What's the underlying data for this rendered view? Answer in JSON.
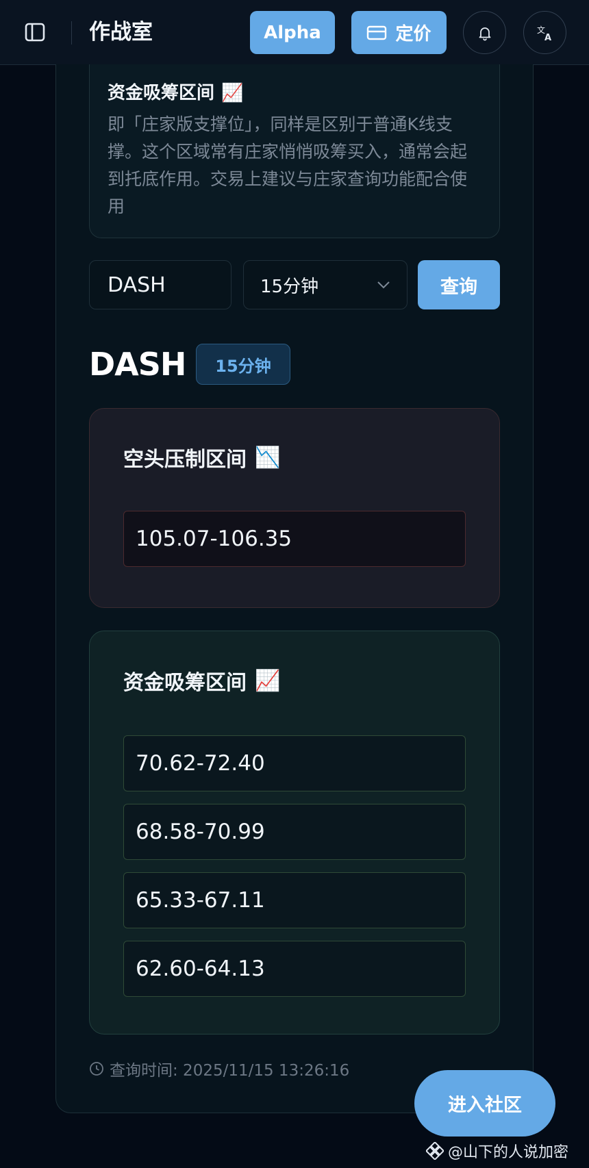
{
  "header": {
    "brand": "作战室",
    "alpha_label": "Alpha",
    "pricing_label": "定价",
    "icons": {
      "sidebar": "sidebar-toggle-icon",
      "pricing": "credit-card-icon",
      "bell": "bell-icon",
      "language": "translate-icon"
    }
  },
  "info_card": {
    "title": "资金吸筹区间",
    "emoji": "📈",
    "description": "即「庄家版支撑位」，同样是区别于普通K线支撑。这个区域常有庄家悄悄吸筹买入，通常会起到托底作用。交易上建议与庄家查询功能配合使用"
  },
  "query_form": {
    "symbol_value": "DASH",
    "symbol_placeholder": "DASH",
    "interval_value": "15分钟",
    "submit_label": "查询"
  },
  "result": {
    "symbol": "DASH",
    "interval_badge": "15分钟",
    "bear_zone": {
      "title": "空头压制区间",
      "emoji": "📉",
      "ranges": [
        "105.07-106.35"
      ]
    },
    "bull_zone": {
      "title": "资金吸筹区间",
      "emoji": "📈",
      "ranges": [
        "70.62-72.40",
        "68.58-70.99",
        "65.33-67.11",
        "62.60-64.13"
      ]
    },
    "query_time": "查询时间: 2025/11/15 13:26:16"
  },
  "community_button": "进入社区",
  "watermark": "@山下的人说加密",
  "colors": {
    "accent": "#64a9e6",
    "background": "#040b16",
    "bear_border": "#4c2a2e",
    "bull_border": "#2f4a37"
  }
}
